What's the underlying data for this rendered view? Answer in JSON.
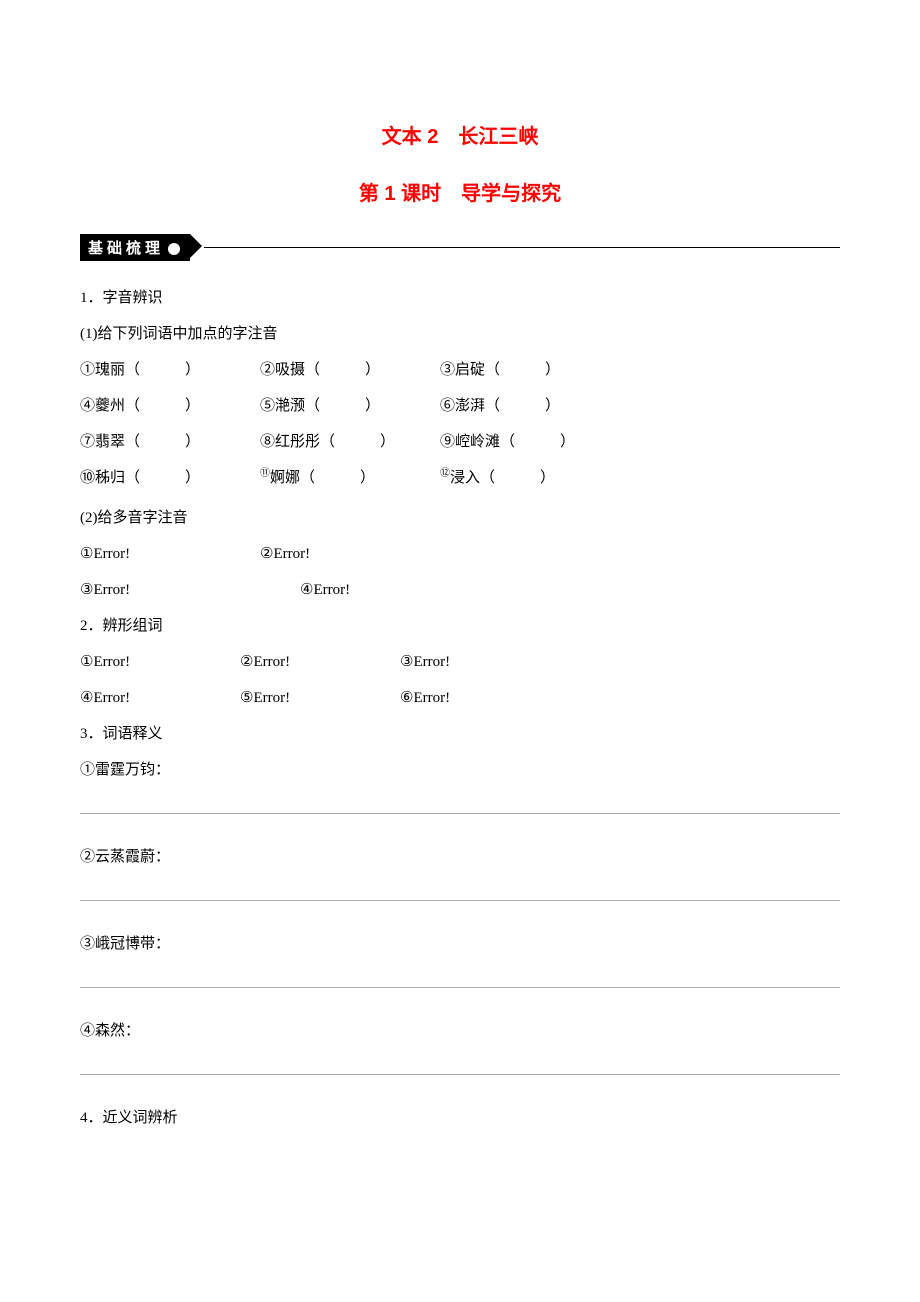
{
  "title": "文本 2　长江三峡",
  "subtitle": "第 1 课时　导学与探究",
  "sectionBanner": "基础梳理",
  "q1": {
    "heading": "1．字音辨识",
    "sub1": "(1)给下列词语中加点的字注音",
    "items": [
      {
        "n": "①",
        "w": "瑰丽（　　　）"
      },
      {
        "n": "②",
        "w": "吸摄（　　　）"
      },
      {
        "n": "③",
        "w": "启碇（　　　）"
      },
      {
        "n": "④",
        "w": "夔州（　　　）"
      },
      {
        "n": "⑤",
        "w": "滟滪（　　　）"
      },
      {
        "n": "⑥",
        "w": "澎湃（　　　）"
      },
      {
        "n": "⑦",
        "w": "翡翠（　　　）"
      },
      {
        "n": "⑧",
        "w": "红彤彤（　　　）"
      },
      {
        "n": "⑨",
        "w": "崆岭滩（　　　）"
      },
      {
        "n": "⑩",
        "w": "秭归（　　　）"
      },
      {
        "n": "⑪",
        "w": "婀娜（　　　）"
      },
      {
        "n": "⑫",
        "w": "浸入（　　　）"
      }
    ],
    "sub2": "(2)给多音字注音",
    "poly": [
      "①Error!",
      "②Error!",
      "③Error!",
      "④Error!"
    ]
  },
  "q2": {
    "heading": "2．辨形组词",
    "items": [
      "①Error!",
      "②Error!",
      "③Error!",
      "④Error!",
      "⑤Error!",
      "⑥Error!"
    ]
  },
  "q3": {
    "heading": "3．词语释义",
    "items": [
      "①雷霆万钧：",
      "②云蒸霞蔚：",
      "③峨冠博带：",
      "④森然："
    ]
  },
  "q4": {
    "heading": "4．近义词辨析"
  }
}
